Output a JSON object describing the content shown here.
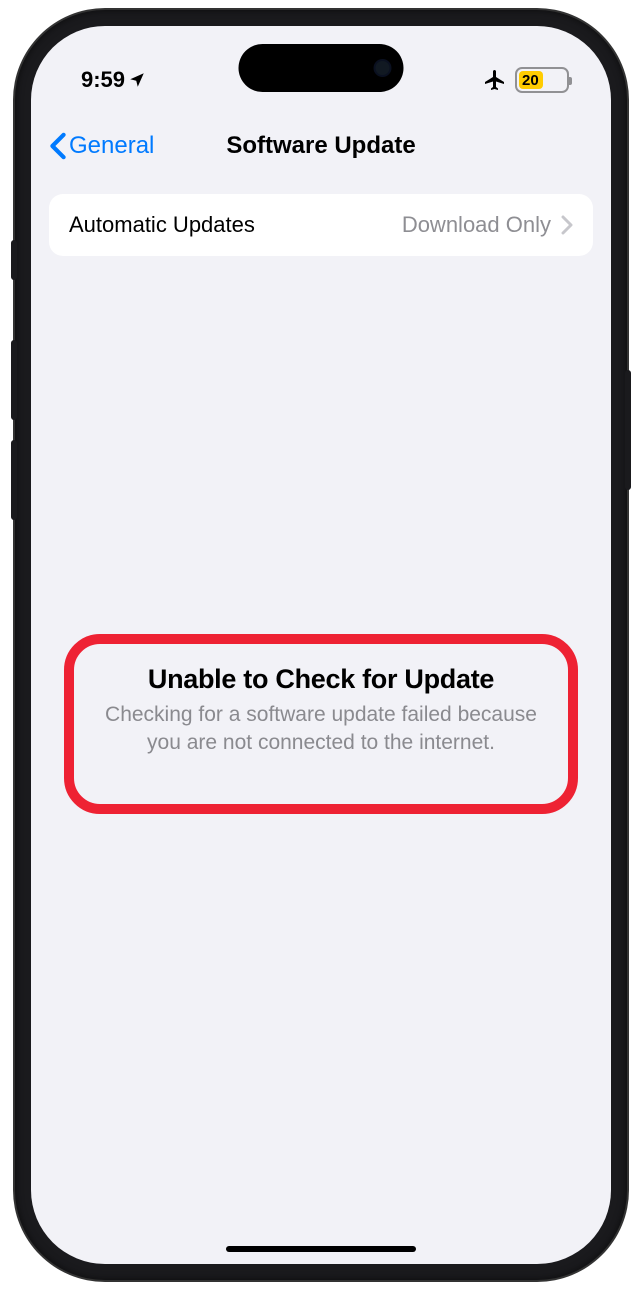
{
  "status_bar": {
    "time": "9:59",
    "battery_percent": "20"
  },
  "nav": {
    "back_label": "General",
    "title": "Software Update"
  },
  "auto_updates": {
    "label": "Automatic Updates",
    "value": "Download Only"
  },
  "error": {
    "title": "Unable to Check for Update",
    "message": "Checking for a software update failed because you are not connected to the internet."
  }
}
